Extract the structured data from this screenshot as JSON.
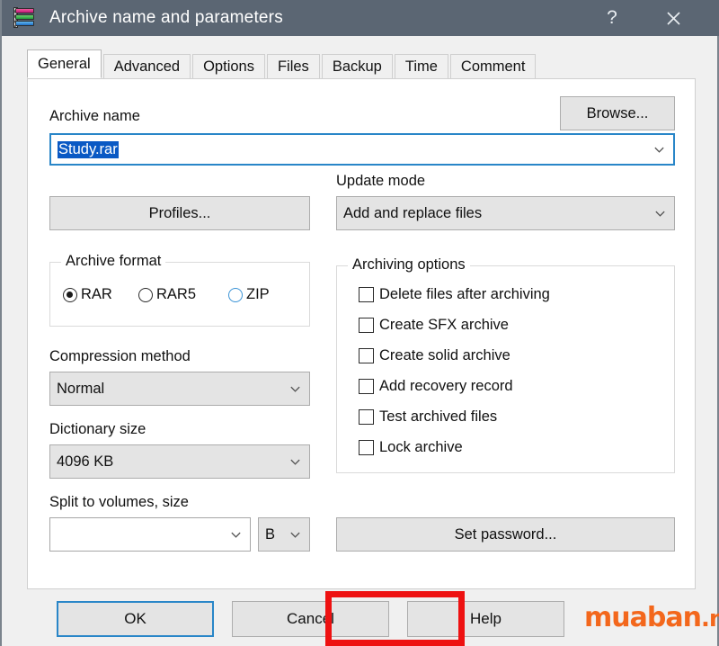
{
  "window": {
    "title": "Archive name and parameters",
    "icon": "winrar-books-icon",
    "titlebar_color": "#5b6673",
    "help_button": "?",
    "close_button": "close-icon"
  },
  "tabs": [
    {
      "label": "General",
      "active": true
    },
    {
      "label": "Advanced",
      "active": false
    },
    {
      "label": "Options",
      "active": false
    },
    {
      "label": "Files",
      "active": false
    },
    {
      "label": "Backup",
      "active": false
    },
    {
      "label": "Time",
      "active": false
    },
    {
      "label": "Comment",
      "active": false
    }
  ],
  "general": {
    "archive_name_label": "Archive name",
    "archive_name_value": "Study.rar",
    "archive_name_selected": true,
    "browse_button": "Browse...",
    "profiles_button": "Profiles...",
    "update_mode_label": "Update mode",
    "update_mode_value": "Add and replace files",
    "archive_format_label": "Archive format",
    "formats": [
      {
        "label": "RAR",
        "checked": true,
        "hover": false
      },
      {
        "label": "RAR5",
        "checked": false,
        "hover": false
      },
      {
        "label": "ZIP",
        "checked": false,
        "hover": true
      }
    ],
    "compression_method_label": "Compression method",
    "compression_method_value": "Normal",
    "dictionary_size_label": "Dictionary size",
    "dictionary_size_value": "4096 KB",
    "split_label": "Split to volumes, size",
    "split_value": "",
    "split_unit_value": "B",
    "archiving_options_label": "Archiving options",
    "archiving_options": [
      {
        "label": "Delete files after archiving",
        "checked": false
      },
      {
        "label": "Create SFX archive",
        "checked": false
      },
      {
        "label": "Create solid archive",
        "checked": false
      },
      {
        "label": "Add recovery record",
        "checked": false
      },
      {
        "label": "Test archived files",
        "checked": false
      },
      {
        "label": "Lock archive",
        "checked": false
      }
    ],
    "set_password_button": "Set password..."
  },
  "footer": {
    "ok_button": "OK",
    "cancel_button": "Cancel",
    "help_button": "Help",
    "ok_focused": true,
    "highlight_color": "#ee1111"
  },
  "watermark": {
    "text": "muaban",
    "suffix": ".net",
    "color": "#f3671c"
  }
}
